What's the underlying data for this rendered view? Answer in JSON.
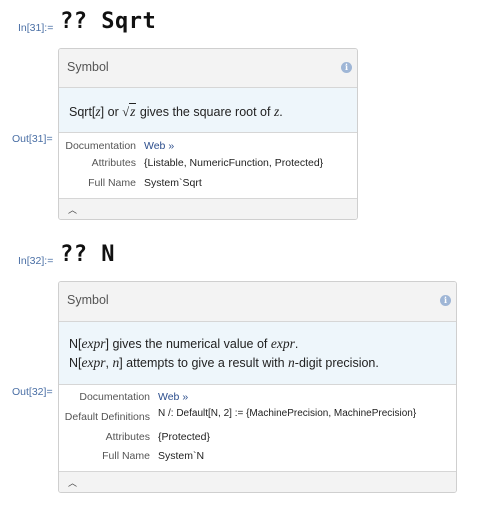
{
  "cells": [
    {
      "in_label": "In[31]:=",
      "input": "?? Sqrt",
      "out_label": "Out[31]=",
      "card_title": "Symbol",
      "info_icon": "info-icon",
      "desc": {
        "fn": "Sqrt[",
        "arg": "z",
        "close": "]",
        "or": " or ",
        "radical": "√",
        "rad_arg": "z",
        "text": " gives the square root of ",
        "end_arg": "z",
        "period": "."
      },
      "rows": [
        {
          "key": "Documentation",
          "value": "Web »"
        },
        {
          "key": "Attributes",
          "value": "{Listable, NumericFunction, Protected}"
        },
        {
          "key": "Full Name",
          "value": "System`Sqrt"
        }
      ],
      "collapse_icon": "chevron-up-icon"
    },
    {
      "in_label": "In[32]:=",
      "input": "?? N",
      "out_label": "Out[32]=",
      "card_title": "Symbol",
      "info_icon": "info-icon",
      "desc1": {
        "fn": "N[",
        "arg": "expr",
        "close": "]",
        "text": " gives the numerical value of ",
        "end_arg": "expr",
        "period": "."
      },
      "desc2": {
        "fn": "N[",
        "arg": "expr",
        "sep": ", ",
        "arg2": "n",
        "close": "]",
        "text": " attempts to give a result with ",
        "n": "n",
        "text2": "-digit precision."
      },
      "rows": [
        {
          "key": "Documentation",
          "value": "Web »"
        },
        {
          "key": "Default Definitions",
          "value": "N /: Default[N, 2] := {MachinePrecision, MachinePrecision}"
        },
        {
          "key": "Attributes",
          "value": "{Protected}"
        },
        {
          "key": "Full Name",
          "value": "System`N"
        }
      ],
      "collapse_icon": "chevron-up-icon"
    }
  ]
}
